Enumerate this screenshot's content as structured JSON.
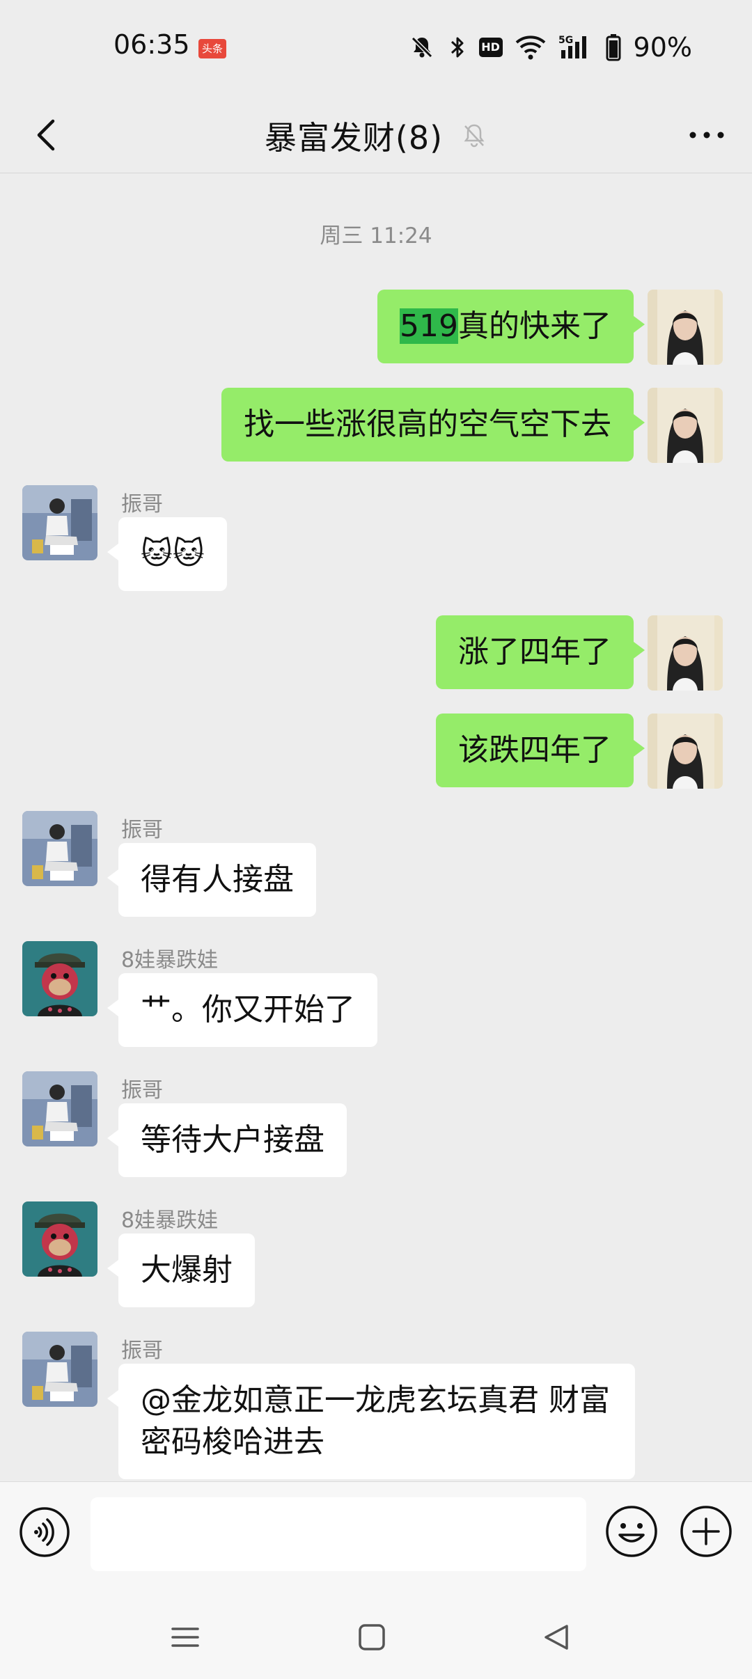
{
  "status_bar": {
    "time": "06:35",
    "badge": "头条",
    "battery": "90%",
    "hd": "HD"
  },
  "header": {
    "title": "暴富发财(8)"
  },
  "chat": {
    "timestamp": "周三 11:24",
    "messages": [
      {
        "side": "me",
        "highlight": "519",
        "text": "真的快来了"
      },
      {
        "side": "me",
        "text": "找一些涨很高的空气空下去"
      },
      {
        "side": "other",
        "sender": "振哥",
        "text": "🐱🐱"
      },
      {
        "side": "me",
        "text": "涨了四年了"
      },
      {
        "side": "me",
        "text": "该跌四年了"
      },
      {
        "side": "other",
        "sender": "振哥",
        "text": "得有人接盘"
      },
      {
        "side": "other",
        "sender": "8娃暴跌娃",
        "text": "艹。你又开始了"
      },
      {
        "side": "other",
        "sender": "振哥",
        "text": "等待大户接盘"
      },
      {
        "side": "other",
        "sender": "8娃暴跌娃",
        "text": "大爆射"
      },
      {
        "side": "other",
        "sender": "振哥",
        "text": "@金龙如意正一龙虎玄坛真君  财富密码梭哈进去"
      }
    ]
  },
  "input": {
    "value": ""
  },
  "icons": {
    "back": "chevron-left-icon",
    "mute": "bell-off-icon",
    "more": "more-dots-icon",
    "voice": "voice-icon",
    "emoji": "emoji-icon",
    "plus": "plus-icon"
  },
  "colors": {
    "my_bubble": "#95ec69",
    "other_bubble": "#ffffff",
    "background": "#ededed",
    "highlight": "#2fb84a"
  }
}
